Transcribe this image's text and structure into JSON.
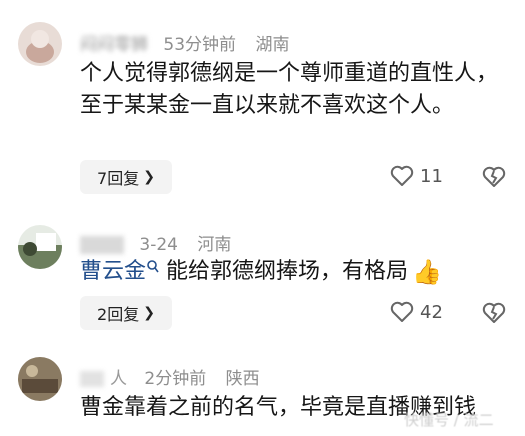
{
  "comments": [
    {
      "name": "闷闷零狮",
      "time": "53分钟前",
      "location": "湖南",
      "text": "个人觉得郭德纲是一个尊师重道的直性人，至于某某金一直以来就不喜欢这个人。",
      "reply_label": "7回复",
      "likes": "11"
    },
    {
      "name": "",
      "time": "3-24",
      "location": "河南",
      "mention": "曹云金",
      "text": "能给郭德纲捧场，有格局",
      "reply_label": "2回复",
      "likes": "42"
    },
    {
      "name": "人",
      "time": "2分钟前",
      "location": "陕西",
      "text": "曹金靠着之前的名气，毕竟是直播赚到钱"
    }
  ],
  "watermark": "快懂号 / 流二",
  "icons": {
    "like": "heart-outline-icon",
    "dislike": "broken-heart-icon",
    "reply_chevron": "chevron-right-icon",
    "mention_badge": "verified-search-icon",
    "thumb": "thumbs-up-emoji"
  }
}
